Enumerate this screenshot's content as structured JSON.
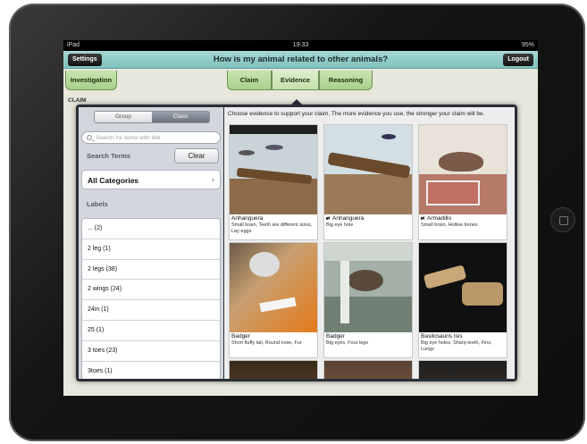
{
  "status_bar": {
    "device": "iPad",
    "wifi": "wifi-icon",
    "time": "19:33",
    "battery": "95%"
  },
  "navbar": {
    "title": "How is my animal related to other animals?",
    "settings_label": "Settings",
    "logout_label": "Logout"
  },
  "tabs": {
    "investigation": "Investigation",
    "claim": "Claim",
    "evidence": "Evidence",
    "reasoning": "Reasoning",
    "active": "Evidence"
  },
  "claim_label": "CLAIM",
  "left_panel": {
    "segment": {
      "group": "Group",
      "class": "Class",
      "selected": "Class"
    },
    "search": {
      "placeholder": "Search for items with title",
      "value": ""
    },
    "search_terms_label": "Search Terms",
    "clear_label": "Clear",
    "all_categories_label": "All Categories",
    "labels_header": "Labels",
    "labels": [
      "... (2)",
      "2 leg (1)",
      "2 legs (38)",
      "2 wings (24)",
      "24in (1)",
      "25 (1)",
      "3 toes (23)",
      "3toes (1)"
    ]
  },
  "right_panel": {
    "instruction": "Choose evidence to support your claim.  The more evidence you use, the stronger your claim will be.",
    "items": [
      {
        "name": "Anhanguera",
        "desc": "Small brain, Teeth are different sizes, Lay eggs",
        "audio": false
      },
      {
        "name": "Anhanguera",
        "desc": "Big eye hole",
        "audio": true
      },
      {
        "name": "Armadillo",
        "desc": "Small brain, Hollow bones",
        "audio": true
      },
      {
        "name": "Badger",
        "desc": "Short fluffy tail, Round nose, Fur",
        "audio": false
      },
      {
        "name": "Badger",
        "desc": "Big eyes, Four legs",
        "audio": false
      },
      {
        "name": "Basilosauris Isis",
        "desc": "Big eye holes, Sharp teeth, Fins, Lungs",
        "audio": false
      }
    ]
  },
  "colors": {
    "navbar": "#8fcbc7",
    "tab": "#b8da9c",
    "popover": "#2a2f36"
  }
}
